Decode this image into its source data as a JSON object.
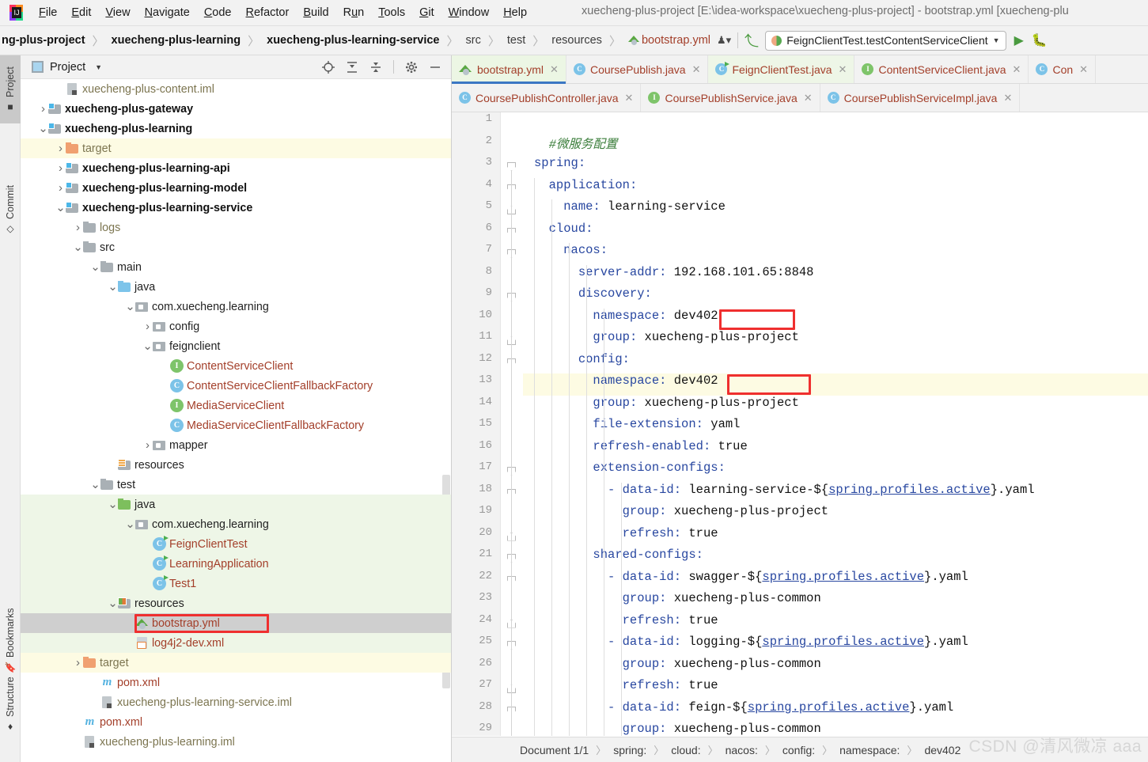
{
  "window": {
    "title": "xuecheng-plus-project [E:\\idea-workspace\\xuecheng-plus-project] - bootstrap.yml [xuecheng-plu"
  },
  "menubar": {
    "items": [
      {
        "label": "File",
        "mnemonic": "F"
      },
      {
        "label": "Edit",
        "mnemonic": "E"
      },
      {
        "label": "View",
        "mnemonic": "V"
      },
      {
        "label": "Navigate",
        "mnemonic": "N"
      },
      {
        "label": "Code",
        "mnemonic": "C"
      },
      {
        "label": "Refactor",
        "mnemonic": "R"
      },
      {
        "label": "Build",
        "mnemonic": "B"
      },
      {
        "label": "Run",
        "mnemonic": "u"
      },
      {
        "label": "Tools",
        "mnemonic": "T"
      },
      {
        "label": "Git",
        "mnemonic": "G"
      },
      {
        "label": "Window",
        "mnemonic": "W"
      },
      {
        "label": "Help",
        "mnemonic": "H"
      }
    ]
  },
  "navbar": {
    "crumbs": [
      {
        "label": "ng-plus-project",
        "style": "bold"
      },
      {
        "label": "xuecheng-plus-learning",
        "style": "bold"
      },
      {
        "label": "xuecheng-plus-learning-service",
        "style": "bold"
      },
      {
        "label": "src",
        "style": "norm"
      },
      {
        "label": "test",
        "style": "norm"
      },
      {
        "label": "resources",
        "style": "norm"
      },
      {
        "label": "bootstrap.yml",
        "style": "file"
      }
    ],
    "run_config": "FeignClientTest.testContentServiceClient",
    "run_button": "run-button",
    "debug_button": "debug-button"
  },
  "rail": {
    "items": [
      {
        "label": "Project",
        "icon": "project-icon",
        "active": true
      },
      {
        "label": "Commit",
        "icon": "commit-icon",
        "active": false
      },
      {
        "label": "Bookmarks",
        "icon": "bookmark-icon",
        "active": false
      },
      {
        "label": "Structure",
        "icon": "structure-icon",
        "active": false
      }
    ]
  },
  "project_panel": {
    "title": "Project",
    "tools": [
      "locate-icon",
      "expand-all-icon",
      "collapse-all-icon",
      "gear-icon",
      "hide-icon"
    ],
    "tree": [
      {
        "label": "xuecheng-plus-content.iml",
        "depth": 3,
        "icon": "iml",
        "arrow": "",
        "color": "olive",
        "hl": ""
      },
      {
        "label": "xuecheng-plus-gateway",
        "depth": 2,
        "icon": "module",
        "arrow": "right",
        "color": "bold",
        "hl": ""
      },
      {
        "label": "xuecheng-plus-learning",
        "depth": 2,
        "icon": "module",
        "arrow": "down",
        "color": "bold",
        "hl": ""
      },
      {
        "label": "target",
        "depth": 3,
        "icon": "folder-orange",
        "arrow": "right",
        "color": "olive",
        "hl": "yellow"
      },
      {
        "label": "xuecheng-plus-learning-api",
        "depth": 3,
        "icon": "module",
        "arrow": "right",
        "color": "bold",
        "hl": ""
      },
      {
        "label": "xuecheng-plus-learning-model",
        "depth": 3,
        "icon": "module",
        "arrow": "right",
        "color": "bold",
        "hl": ""
      },
      {
        "label": "xuecheng-plus-learning-service",
        "depth": 3,
        "icon": "module",
        "arrow": "down",
        "color": "bold",
        "hl": ""
      },
      {
        "label": "logs",
        "depth": 4,
        "icon": "folder",
        "arrow": "right",
        "color": "olive",
        "hl": ""
      },
      {
        "label": "src",
        "depth": 4,
        "icon": "folder",
        "arrow": "down",
        "color": "dark",
        "hl": ""
      },
      {
        "label": "main",
        "depth": 5,
        "icon": "folder",
        "arrow": "down",
        "color": "dark",
        "hl": ""
      },
      {
        "label": "java",
        "depth": 6,
        "icon": "folder-blue",
        "arrow": "down",
        "color": "dark",
        "hl": ""
      },
      {
        "label": "com.xuecheng.learning",
        "depth": 7,
        "icon": "package",
        "arrow": "down",
        "color": "dark",
        "hl": ""
      },
      {
        "label": "config",
        "depth": 8,
        "icon": "package",
        "arrow": "right",
        "color": "dark",
        "hl": ""
      },
      {
        "label": "feignclient",
        "depth": 8,
        "icon": "package",
        "arrow": "down",
        "color": "dark",
        "hl": ""
      },
      {
        "label": "ContentServiceClient",
        "depth": 9,
        "icon": "interface",
        "arrow": "",
        "color": "red",
        "hl": ""
      },
      {
        "label": "ContentServiceClientFallbackFactory",
        "depth": 9,
        "icon": "class",
        "arrow": "",
        "color": "red",
        "hl": ""
      },
      {
        "label": "MediaServiceClient",
        "depth": 9,
        "icon": "interface",
        "arrow": "",
        "color": "red",
        "hl": ""
      },
      {
        "label": "MediaServiceClientFallbackFactory",
        "depth": 9,
        "icon": "class",
        "arrow": "",
        "color": "red",
        "hl": ""
      },
      {
        "label": "mapper",
        "depth": 8,
        "icon": "package",
        "arrow": "right",
        "color": "dark",
        "hl": ""
      },
      {
        "label": "resources",
        "depth": 6,
        "icon": "folder-resources",
        "arrow": "",
        "color": "dark",
        "hl": ""
      },
      {
        "label": "test",
        "depth": 5,
        "icon": "folder",
        "arrow": "down",
        "color": "dark",
        "hl": ""
      },
      {
        "label": "java",
        "depth": 6,
        "icon": "folder-green",
        "arrow": "down",
        "color": "dark",
        "hl": "green"
      },
      {
        "label": "com.xuecheng.learning",
        "depth": 7,
        "icon": "package",
        "arrow": "down",
        "color": "dark",
        "hl": "green"
      },
      {
        "label": "FeignClientTest",
        "depth": 8,
        "icon": "class-run",
        "arrow": "",
        "color": "red",
        "hl": "green"
      },
      {
        "label": "LearningApplication",
        "depth": 8,
        "icon": "class-run",
        "arrow": "",
        "color": "red",
        "hl": "green"
      },
      {
        "label": "Test1",
        "depth": 8,
        "icon": "class-run",
        "arrow": "",
        "color": "red",
        "hl": "green"
      },
      {
        "label": "resources",
        "depth": 6,
        "icon": "folder-testres",
        "arrow": "down",
        "color": "dark",
        "hl": "green"
      },
      {
        "label": "bootstrap.yml",
        "depth": 7,
        "icon": "yml",
        "arrow": "",
        "color": "red",
        "hl": "sel",
        "boxed": true
      },
      {
        "label": "log4j2-dev.xml",
        "depth": 7,
        "icon": "xml",
        "arrow": "",
        "color": "red",
        "hl": "green"
      },
      {
        "label": "target",
        "depth": 4,
        "icon": "folder-orange",
        "arrow": "right",
        "color": "olive",
        "hl": "yellow"
      },
      {
        "label": "pom.xml",
        "depth": 5,
        "icon": "maven",
        "arrow": "",
        "color": "red",
        "hl": ""
      },
      {
        "label": "xuecheng-plus-learning-service.iml",
        "depth": 5,
        "icon": "iml",
        "arrow": "",
        "color": "olive",
        "hl": ""
      },
      {
        "label": "pom.xml",
        "depth": 4,
        "icon": "maven",
        "arrow": "",
        "color": "red",
        "hl": ""
      },
      {
        "label": "xuecheng-plus-learning.iml",
        "depth": 4,
        "icon": "iml",
        "arrow": "",
        "color": "olive",
        "hl": ""
      }
    ]
  },
  "editor": {
    "tabs_row1": [
      {
        "label": "bootstrap.yml",
        "icon": "yml",
        "state": "selected"
      },
      {
        "label": "CoursePublish.java",
        "icon": "class",
        "state": "normal"
      },
      {
        "label": "FeignClientTest.java",
        "icon": "class-run",
        "state": "active-file"
      },
      {
        "label": "ContentServiceClient.java",
        "icon": "interface",
        "state": "normal"
      },
      {
        "label": "Con",
        "icon": "class",
        "state": "normal"
      }
    ],
    "tabs_row2": [
      {
        "label": "CoursePublishController.java",
        "icon": "class",
        "state": "normal"
      },
      {
        "label": "CoursePublishService.java",
        "icon": "interface",
        "state": "normal"
      },
      {
        "label": "CoursePublishServiceImpl.java",
        "icon": "class",
        "state": "normal"
      }
    ],
    "lines": [
      {
        "n": 1,
        "text": "",
        "cur": false
      },
      {
        "n": 2,
        "text": "  #微服务配置",
        "cur": false
      },
      {
        "n": 3,
        "text": "spring:",
        "cur": false
      },
      {
        "n": 4,
        "text": "  application:",
        "cur": false
      },
      {
        "n": 5,
        "text": "    name: learning-service",
        "cur": false
      },
      {
        "n": 6,
        "text": "  cloud:",
        "cur": false
      },
      {
        "n": 7,
        "text": "    nacos:",
        "cur": false
      },
      {
        "n": 8,
        "text": "      server-addr: 192.168.101.65:8848",
        "cur": false
      },
      {
        "n": 9,
        "text": "      discovery:",
        "cur": false
      },
      {
        "n": 10,
        "text": "        namespace: dev402",
        "cur": false
      },
      {
        "n": 11,
        "text": "        group: xuecheng-plus-project",
        "cur": false
      },
      {
        "n": 12,
        "text": "      config:",
        "cur": false
      },
      {
        "n": 13,
        "text": "        namespace: dev402",
        "cur": true
      },
      {
        "n": 14,
        "text": "        group: xuecheng-plus-project",
        "cur": false
      },
      {
        "n": 15,
        "text": "        file-extension: yaml",
        "cur": false
      },
      {
        "n": 16,
        "text": "        refresh-enabled: true",
        "cur": false
      },
      {
        "n": 17,
        "text": "        extension-configs:",
        "cur": false
      },
      {
        "n": 18,
        "text": "          - data-id: learning-service-${spring.profiles.active}.yaml",
        "cur": false
      },
      {
        "n": 19,
        "text": "            group: xuecheng-plus-project",
        "cur": false
      },
      {
        "n": 20,
        "text": "            refresh: true",
        "cur": false
      },
      {
        "n": 21,
        "text": "        shared-configs:",
        "cur": false
      },
      {
        "n": 22,
        "text": "          - data-id: swagger-${spring.profiles.active}.yaml",
        "cur": false
      },
      {
        "n": 23,
        "text": "            group: xuecheng-plus-common",
        "cur": false
      },
      {
        "n": 24,
        "text": "            refresh: true",
        "cur": false
      },
      {
        "n": 25,
        "text": "          - data-id: logging-${spring.profiles.active}.yaml",
        "cur": false
      },
      {
        "n": 26,
        "text": "            group: xuecheng-plus-common",
        "cur": false
      },
      {
        "n": 27,
        "text": "            refresh: true",
        "cur": false
      },
      {
        "n": 28,
        "text": "          - data-id: feign-${spring.profiles.active}.yaml",
        "cur": false
      },
      {
        "n": 29,
        "text": "            group: xuecheng-plus-common",
        "cur": false
      }
    ],
    "highlighted_values": [
      "dev402",
      "dev402"
    ]
  },
  "statusbar": {
    "document": "Document 1/1",
    "crumbs": [
      "spring:",
      "cloud:",
      "nacos:",
      "config:",
      "namespace:",
      "dev402"
    ],
    "watermark": "CSDN @清风微凉 aaa"
  },
  "colors": {
    "accent_blue": "#3b77c4",
    "highlight_red": "#ef2f2f",
    "selection_gray": "#cfcfcf",
    "test_green": "#eef6e7",
    "target_yellow": "#fdfbe3",
    "key_blue": "#2847a0",
    "string_red": "#a33f2a"
  }
}
